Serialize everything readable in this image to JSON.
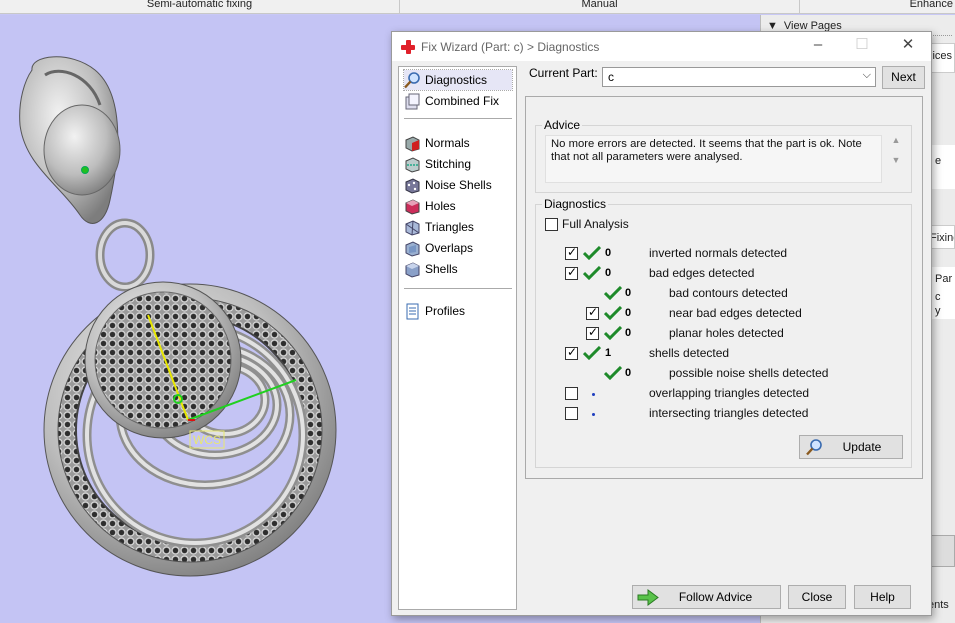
{
  "topbar": {
    "items": [
      "Semi-automatic fixing",
      "Manual",
      "Enhance"
    ]
  },
  "right_panel": {
    "view_pages": "View Pages",
    "fragments": [
      "lices",
      "e",
      "Fixing",
      "Par",
      "c",
      "y",
      "ents"
    ]
  },
  "dialog": {
    "title": "Fix Wizard (Part: c) > Diagnostics",
    "nav": [
      {
        "label": "Diagnostics",
        "icon": "magnifier-icon",
        "selected": true
      },
      {
        "label": "Combined Fix",
        "icon": "combined-fix-icon"
      },
      {
        "label": "Normals",
        "icon": "normals-icon"
      },
      {
        "label": "Stitching",
        "icon": "stitching-icon"
      },
      {
        "label": "Noise Shells",
        "icon": "noise-shells-icon"
      },
      {
        "label": "Holes",
        "icon": "holes-icon"
      },
      {
        "label": "Triangles",
        "icon": "triangles-icon"
      },
      {
        "label": "Overlaps",
        "icon": "overlaps-icon"
      },
      {
        "label": "Shells",
        "icon": "shells-icon"
      },
      {
        "label": "Profiles",
        "icon": "profiles-icon"
      }
    ],
    "current_part_label": "Current Part:",
    "current_part_value": "c",
    "next_label": "Next",
    "advice_title": "Advice",
    "advice_text": "No more errors are detected. It seems that the part is ok. Note that not all parameters were analysed.",
    "diagnostics_title": "Diagnostics",
    "full_analysis_label": "Full Analysis",
    "rows": [
      {
        "label": "inverted normals detected",
        "count": "0",
        "checked": true,
        "status": "ok"
      },
      {
        "label": "bad edges detected",
        "count": "0",
        "checked": true,
        "status": "ok"
      },
      {
        "label": "bad contours detected",
        "count": "0",
        "checked": null,
        "status": "ok"
      },
      {
        "label": "near bad edges detected",
        "count": "0",
        "checked": true,
        "status": "ok"
      },
      {
        "label": "planar holes detected",
        "count": "0",
        "checked": true,
        "status": "ok"
      },
      {
        "label": "shells detected",
        "count": "1",
        "checked": true,
        "status": "ok"
      },
      {
        "label": "possible noise shells detected",
        "count": "0",
        "checked": null,
        "status": "ok"
      },
      {
        "label": "overlapping triangles detected",
        "count": "",
        "checked": false,
        "status": "dot"
      },
      {
        "label": "intersecting triangles detected",
        "count": "",
        "checked": false,
        "status": "dot"
      }
    ],
    "update_label": "Update",
    "follow_advice_label": "Follow Advice",
    "close_label": "Close",
    "help_label": "Help"
  },
  "viewport": {
    "wcs_label": "WCS"
  },
  "colors": {
    "viewport_bg": "#c4c4f4",
    "check_green": "#1e8a2a",
    "title_cross": "#e0202a"
  }
}
